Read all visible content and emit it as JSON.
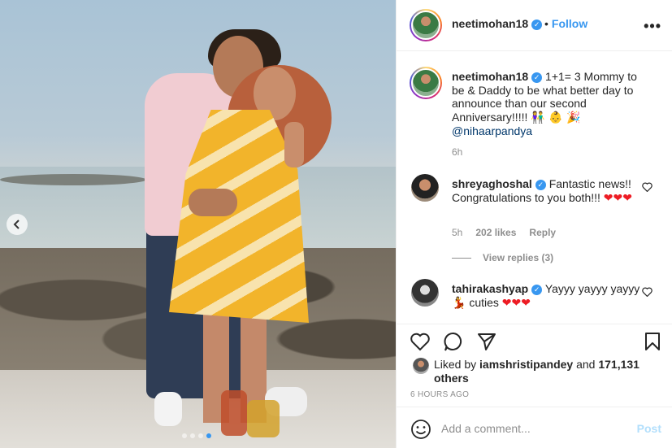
{
  "header": {
    "username": "neetimohan18",
    "follow_dot": "•",
    "follow_label": "Follow",
    "more_label": "•••"
  },
  "caption": {
    "username": "neetimohan18",
    "text_1": "1+1= 3",
    "text_2": "Mommy to be & Daddy to be what better day to announce than our second Anniversary!!!!!",
    "emojis": "👫 👶 🎉",
    "mention": "@nihaarpandya",
    "time": "6h"
  },
  "comments": [
    {
      "username": "shreyaghoshal",
      "text": "Fantastic news!! Congratulations to you both!!!",
      "hearts": "❤❤❤",
      "time": "5h",
      "likes": "202 likes",
      "reply_label": "Reply"
    },
    {
      "username": "tahirakashyap",
      "text_1": "Yayyy yayyy yayyy",
      "emoji": "💃",
      "text_2": "cuties",
      "hearts": "❤❤❤"
    }
  ],
  "view_replies": "View replies (3)",
  "likes": {
    "liked_by": "Liked by",
    "user": "iamshristipandey",
    "and": "and",
    "others": "171,131 others"
  },
  "timestamp": "6 HOURS AGO",
  "add_comment": {
    "placeholder": "Add a comment...",
    "post_label": "Post"
  },
  "carousel": {
    "prev_icon": "chevron-left",
    "dot_count": 4,
    "active_index": 3
  },
  "colors": {
    "accent": "#3897f0",
    "post_disabled": "#b2dffc",
    "heart": "#ed1c24"
  }
}
